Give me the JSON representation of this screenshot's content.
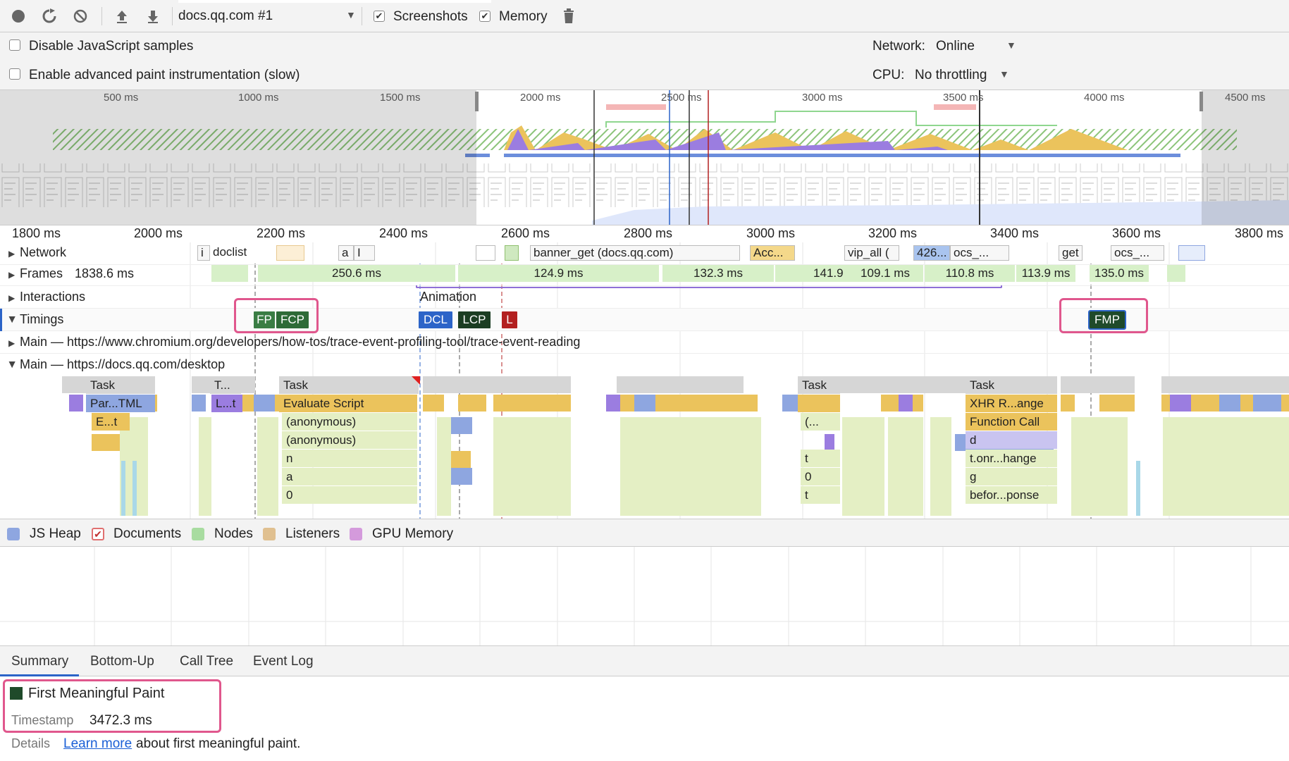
{
  "toolbar": {
    "url_select": "docs.qq.com #1",
    "screenshots_label": "Screenshots",
    "memory_label": "Memory",
    "screenshots_checked": true,
    "memory_checked": true
  },
  "settings": {
    "disable_js_label": "Disable JavaScript samples",
    "advanced_paint_label": "Enable advanced paint instrumentation (slow)",
    "network_label": "Network:",
    "network_value": "Online",
    "cpu_label": "CPU:",
    "cpu_value": "No throttling"
  },
  "overview": {
    "ticks": [
      "500 ms",
      "1000 ms",
      "1500 ms",
      "2000 ms",
      "2500 ms",
      "3000 ms",
      "3500 ms",
      "4000 ms",
      "4500 ms"
    ]
  },
  "ruler": {
    "ticks": [
      "1800 ms",
      "2000 ms",
      "2200 ms",
      "2400 ms",
      "2600 ms",
      "2800 ms",
      "3000 ms",
      "3200 ms",
      "3400 ms",
      "3600 ms",
      "3800 ms"
    ]
  },
  "tracks": {
    "network": "Network",
    "frames": "Frames",
    "interactions": "Interactions",
    "timings": "Timings",
    "main1": "Main — https://www.chromium.org/developers/how-tos/trace-event-profiling-tool/trace-event-reading",
    "main2": "Main — https://docs.qq.com/desktop"
  },
  "network_items": [
    "i",
    "doclist",
    "a",
    "I",
    "banner_get (docs.qq.com)",
    "Acc...",
    "vip_all (",
    "426...",
    "ocs_...",
    "get",
    "ocs_..."
  ],
  "frames": [
    "1838.6 ms",
    "250.6 ms",
    "124.9 ms",
    "132.3 ms",
    "141.9 ms",
    "109.1 ms",
    "110.8 ms",
    "113.9 ms",
    "135.0 ms"
  ],
  "interactions": {
    "animation": "Animation"
  },
  "timings": {
    "fp": "FP",
    "fcp": "FCP",
    "dcl": "DCL",
    "lcp": "LCP",
    "l": "L",
    "fmp": "FMP",
    "colors": {
      "fp": "#3a7d44",
      "fcp": "#2e6b37",
      "dcl": "#2c64c8",
      "lcp": "#1b3d22",
      "l": "#b32020",
      "fmp": "#1f4a2a"
    }
  },
  "flame": {
    "task": "Task",
    "t_short": "T...",
    "parse_html": "Par...TML",
    "l_t": "L...t",
    "e_t": "E...t",
    "evaluate_script": "Evaluate Script",
    "anonymous": "(anonymous)",
    "n": "n",
    "a": "a",
    "zero": "0",
    "paren": "(...",
    "t": "t",
    "xhr": "XHR R...ange",
    "function_call": "Function Call",
    "d": "d",
    "onr": "t.onr...hange",
    "g": "g",
    "before": "befor...ponse"
  },
  "legend": [
    "JS Heap",
    "Documents",
    "Nodes",
    "Listeners",
    "GPU Memory"
  ],
  "legend_colors": [
    "#8ea6e0",
    "#e07070",
    "#a8dca0",
    "#e0c090",
    "#d49adc"
  ],
  "tabs": [
    "Summary",
    "Bottom-Up",
    "Call Tree",
    "Event Log"
  ],
  "summary": {
    "title": "First Meaningful Paint",
    "timestamp_label": "Timestamp",
    "timestamp_value": "3472.3 ms",
    "details_label": "Details",
    "learn_more": "Learn more",
    "details_suffix": "about first meaningful paint."
  }
}
